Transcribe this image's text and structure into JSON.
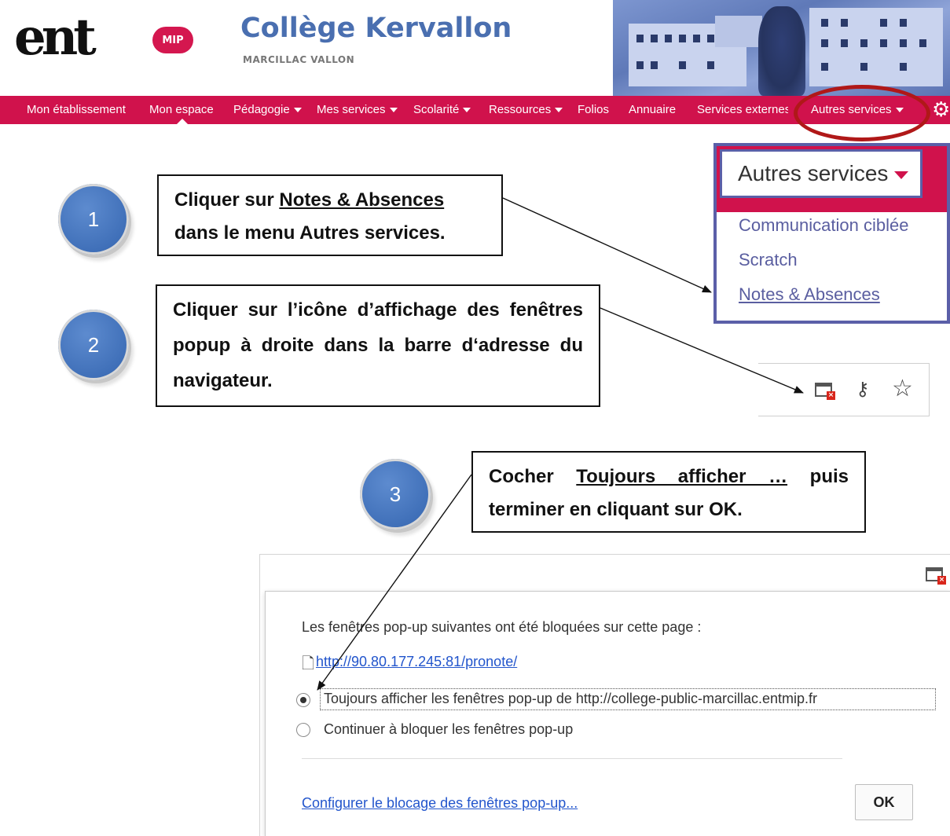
{
  "header": {
    "logo_text": "ent",
    "logo_badge": "MIP",
    "school_name": "Collège Kervallon",
    "school_city": "MARCILLAC VALLON"
  },
  "nav": {
    "items": [
      {
        "label": "Mon établissement",
        "dropdown": false
      },
      {
        "label": "Mon espace",
        "dropdown": false,
        "active": true
      },
      {
        "label": "Pédagogie",
        "dropdown": true
      },
      {
        "label": "Mes services",
        "dropdown": true
      },
      {
        "label": "Scolarité",
        "dropdown": true
      },
      {
        "label": "Ressources",
        "dropdown": true
      },
      {
        "label": "Folios",
        "dropdown": false
      },
      {
        "label": "Annuaire",
        "dropdown": false
      },
      {
        "label": "Services externes",
        "dropdown": false
      },
      {
        "label": "Autres services",
        "dropdown": true,
        "highlighted": true
      }
    ],
    "settings_icon": "gear-icon",
    "color": "#d0124c"
  },
  "steps": [
    {
      "number": "1",
      "text_before": "Cliquer sur ",
      "text_underlined": "Notes & Absences",
      "text_after": " dans le menu Autres services."
    },
    {
      "number": "2",
      "text": "Cliquer sur l’icône d’affichage des fenêtres popup à droite dans la barre d‘adresse du navigateur."
    },
    {
      "number": "3",
      "text_before": "Cocher ",
      "text_underlined": "Toujours afficher …",
      "text_after": " puis terminer en cliquant sur OK."
    }
  ],
  "dropdown": {
    "title": "Autres services",
    "items": [
      "Communication ciblée",
      "Scratch",
      "Notes & Absences"
    ]
  },
  "address_bar": {
    "icons": [
      "popup-blocked-icon",
      "key-icon",
      "star-icon"
    ]
  },
  "popup_dialog": {
    "message": "Les fenêtres pop-up suivantes ont été bloquées sur cette page :",
    "blocked_url": "http://90.80.177.245:81/pronote/",
    "option_always": "Toujours afficher les fenêtres pop-up de http://college-public-marcillac.entmip.fr",
    "option_block": "Continuer à bloquer les fenêtres pop-up",
    "selected_option": "always",
    "manage_link": "Configurer le blocage des fenêtres pop-up...",
    "ok_label": "OK"
  },
  "colors": {
    "accent": "#d0124c",
    "step_blue": "#3f6fb8",
    "highlight_ring": "#b01818",
    "dropdown_border": "#5b5fa8"
  }
}
